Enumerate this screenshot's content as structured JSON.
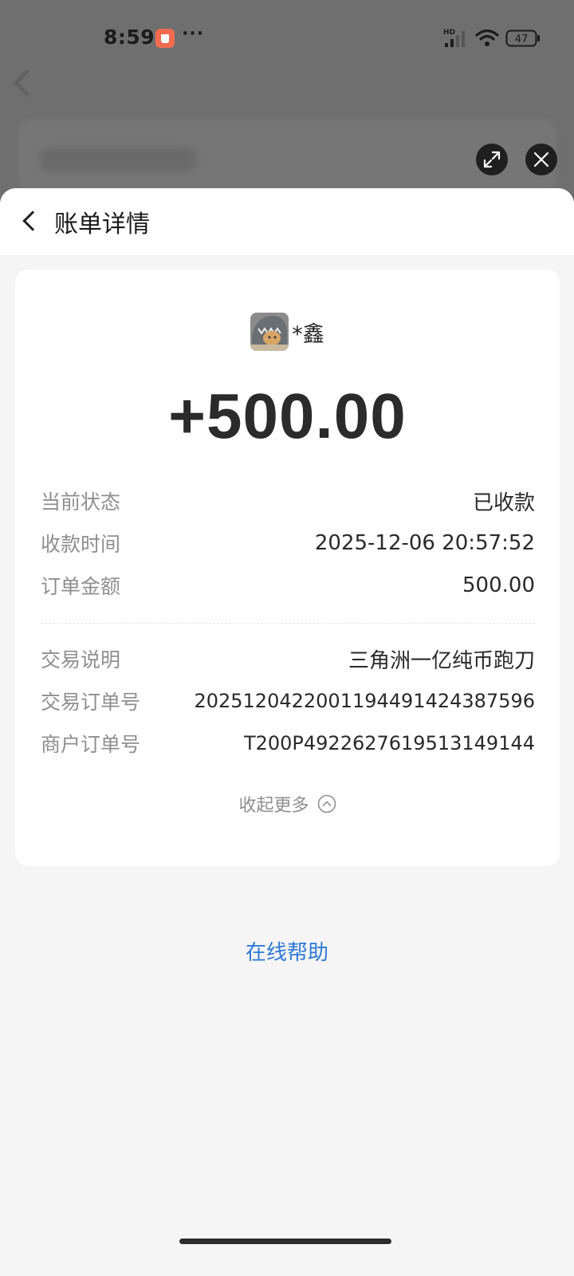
{
  "status_bar": {
    "time": "8:59",
    "more": "···",
    "network_badge": "HD",
    "battery_level": "47"
  },
  "sheet": {
    "title": "账单详情"
  },
  "bill": {
    "payer_name": "*鑫",
    "amount": "+500.00",
    "details": [
      {
        "label": "当前状态",
        "value": "已收款"
      },
      {
        "label": "收款时间",
        "value": "2025-12-06 20:57:52"
      },
      {
        "label": "订单金额",
        "value": "500.00"
      }
    ],
    "extra_details": [
      {
        "label": "交易说明",
        "value": "三角洲一亿纯币跑刀"
      },
      {
        "label": "交易订单号",
        "value": "2025120422001194491424387596"
      },
      {
        "label": "商户订单号",
        "value": "T200P4922627619513149144"
      }
    ],
    "collapse_label": "收起更多"
  },
  "help_link": "在线帮助",
  "colors": {
    "accent_link": "#2f78d6",
    "notification": "#f26b4f"
  }
}
